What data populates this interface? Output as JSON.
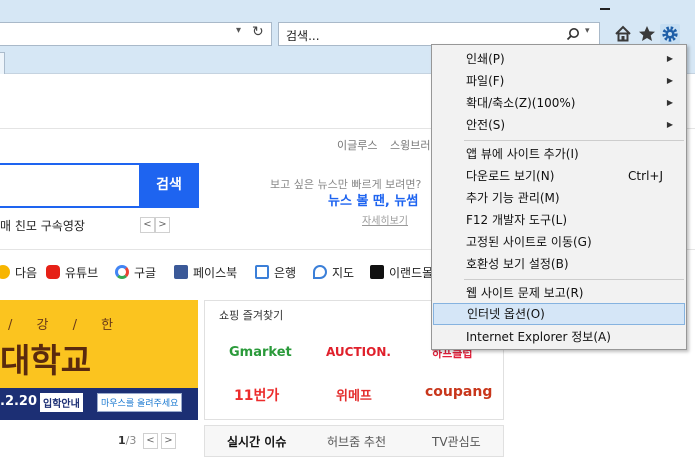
{
  "toolbar": {
    "search_placeholder": "검색...",
    "address_dropdown": "▾",
    "refresh": "↻",
    "search_dropdown": "▾",
    "icons": [
      "minimize-icon",
      "home-icon",
      "star-icon",
      "gear-icon",
      "search-icon",
      "refresh-icon"
    ]
  },
  "page": {
    "top_links": [
      "이글루스",
      "스윙브러"
    ],
    "search_button": "검색",
    "news_prompt": "보고 싶은 뉴스만 빠르게 보려면?",
    "news_cta": "뉴스 볼 땐, 뉴썸",
    "news_more": "자세히보기",
    "ticker_text": "매 친모 구속영장",
    "ticker_prev": "<",
    "ticker_next": ">",
    "quick_links": [
      "다음",
      "유튜브",
      "구글",
      "페이스북",
      "은행",
      "지도",
      "이랜드몰"
    ],
    "banner": {
      "line1": "/ 강 / 한",
      "line2": "대학교",
      "date": ".2.20",
      "admission": "입학안내",
      "mouse_hint": "마우스를 올려주세요"
    },
    "pager_current": "1",
    "pager_total": "/3",
    "pager_prev": "<",
    "pager_next": ">",
    "shopping_title": "쇼핑 즐겨찾기",
    "brands": [
      "Gmarket",
      "AUCTION.",
      "11번가",
      "위메프",
      "coupang",
      "하프클럽"
    ],
    "bottom_tabs": [
      "실시간 이슈",
      "허브줌 추천",
      "TV관심도"
    ]
  },
  "menu": {
    "groups": [
      [
        {
          "label": "인쇄(P)",
          "submenu": true
        },
        {
          "label": "파일(F)",
          "submenu": true
        },
        {
          "label": "확대/축소(Z)(100%)",
          "submenu": true
        },
        {
          "label": "안전(S)",
          "submenu": true
        }
      ],
      [
        {
          "label": "앱 뷰에 사이트 추가(I)"
        },
        {
          "label": "다운로드 보기(N)",
          "shortcut": "Ctrl+J"
        },
        {
          "label": "추가 기능 관리(M)"
        },
        {
          "label": "F12 개발자 도구(L)"
        },
        {
          "label": "고정된 사이트로 이동(G)"
        },
        {
          "label": "호환성 보기 설정(B)"
        }
      ],
      [
        {
          "label": "웹 사이트 문제 보고(R)"
        },
        {
          "label": "인터넷 옵션(O)",
          "highlighted": true
        },
        {
          "label": "Internet Explorer 정보(A)"
        }
      ]
    ]
  },
  "colors": {
    "chrome": "#d6e7f5",
    "search_blue": "#1e64f0",
    "banner_yellow": "#fbc41f",
    "menu_bg": "#f2f2f2",
    "menu_highlight": "#d5e6f7"
  }
}
